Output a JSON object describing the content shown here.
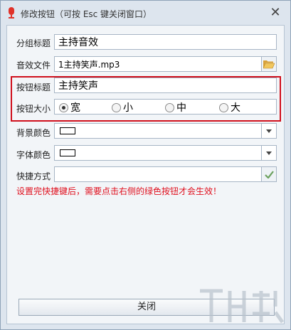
{
  "window": {
    "title": "修改按钮（可按 Esc 键关闭窗口）",
    "close_glyph": "✕"
  },
  "form": {
    "group_title": {
      "label": "分组标题",
      "value": "主持音效"
    },
    "audio_file": {
      "label": "音效文件",
      "value": "1主持笑声.mp3"
    },
    "button_title": {
      "label": "按钮标题",
      "value": "主持笑声"
    },
    "button_size": {
      "label": "按钮大小",
      "options": [
        "宽",
        "小",
        "中",
        "大"
      ],
      "selected": "宽"
    },
    "bg_color": {
      "label": "背景颜色",
      "value": "#FFFFFF"
    },
    "font_color": {
      "label": "字体颜色",
      "value": "#FFFFFF"
    },
    "shortcut": {
      "label": "快捷方式",
      "value": ""
    },
    "warning": "设置完快捷键后，需要点击右侧的绿色按钮才会生效！",
    "close_label": "关闭"
  },
  "colors": {
    "highlight": "#D0101C",
    "warning": "#E0101E",
    "confirm": "#6BA15E",
    "folder": "#E8B84A"
  },
  "icons": {
    "app": "microphone-icon",
    "folder": "folder-open-icon",
    "dropdown": "chevron-down-icon",
    "confirm": "check-icon"
  }
}
